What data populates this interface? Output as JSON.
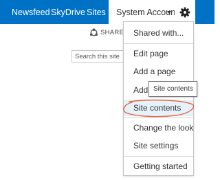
{
  "top_nav": {
    "links": [
      "Newsfeed",
      "SkyDrive",
      "Sites"
    ],
    "account_name": "System Account",
    "settings_icon": "gear-icon",
    "bar_color": "#0072c6"
  },
  "page": {
    "share_label": "SHARE",
    "share_icon": "share-icon",
    "search_placeholder": "Search this site"
  },
  "settings_menu": {
    "items": [
      {
        "label": "Shared with..."
      },
      {
        "label": "Edit page"
      },
      {
        "label": "Add a page"
      },
      {
        "label": "Add"
      },
      {
        "label": "Site contents",
        "highlighted": true
      },
      {
        "label": "Change the look"
      },
      {
        "label": "Site settings"
      },
      {
        "label": "Getting started"
      }
    ],
    "highlight_color": "#e6f2fa"
  },
  "tooltip": {
    "text": "Site contents"
  },
  "annotation": {
    "color": "#e8623a"
  }
}
